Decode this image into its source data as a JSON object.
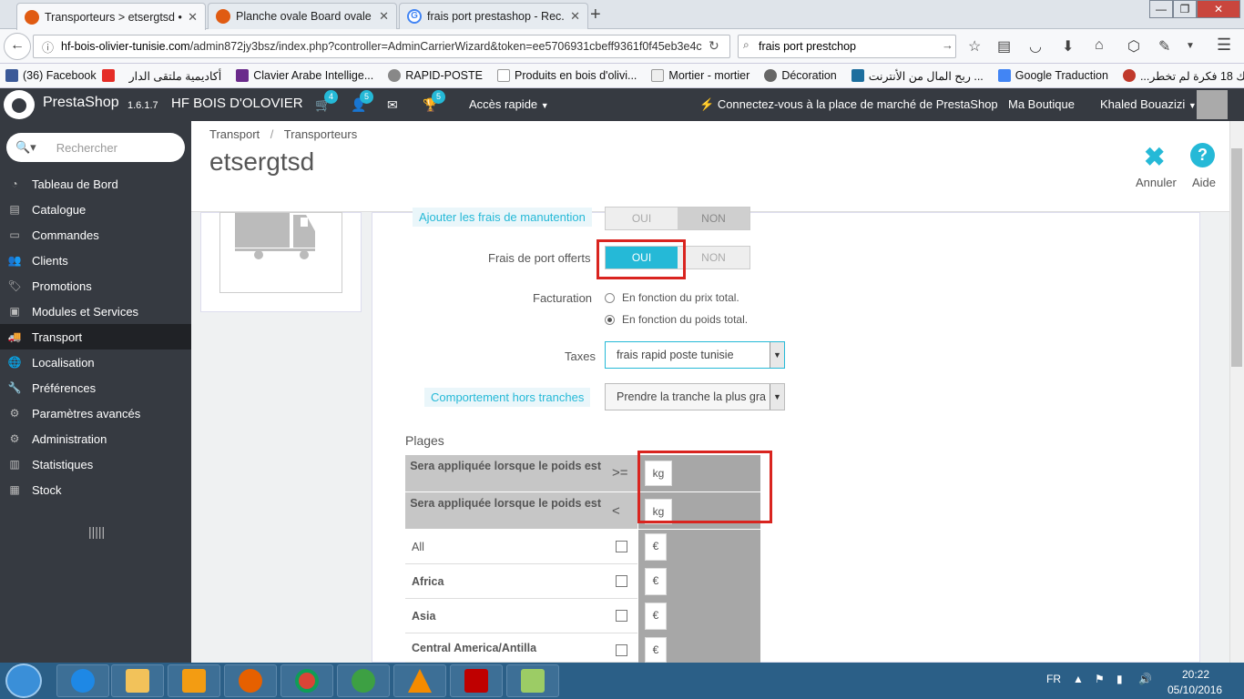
{
  "browser": {
    "tabs": [
      {
        "title": "Transporteurs > etsergtsd •..."
      },
      {
        "title": "Planche ovale Board ovale ..."
      },
      {
        "title": "frais port prestashop - Rec..."
      }
    ],
    "url_host": "hf-bois-olivier-tunisie.com",
    "url_path": "/admin872jy3bsz/index.php?controller=AdminCarrierWizard&token=ee5706931cbeff9361f0f45eb3e4c",
    "search_value": "frais port prestchop",
    "bookmarks": [
      "(36) Facebook",
      "أكاديمية ملتقى الدار",
      "Clavier Arabe Intellige...",
      "RAPID-POSTE",
      "Produits en bois d'olivi...",
      "Mortier - mortier",
      "Décoration",
      "ربح المال من الأنترنت ...",
      "Google Traduction",
      "...إليك 18 فكرة لم تخطر"
    ]
  },
  "header": {
    "brand": "PrestaShop",
    "version": "1.6.1.7",
    "shop_name": "HF BOIS D'OLOVIER",
    "badges": {
      "cart": "4",
      "customers": "5",
      "trophy": "5"
    },
    "quick_access": "Accès rapide",
    "marketplace": "Connectez-vous à la place de marché de PrestaShop",
    "my_shop": "Ma Boutique",
    "user": "Khaled Bouazizi"
  },
  "sidebar": {
    "search_placeholder": "Rechercher",
    "items": [
      {
        "label": "Tableau de Bord",
        "icon": "dashboard-icon"
      },
      {
        "label": "Catalogue",
        "icon": "book-icon"
      },
      {
        "label": "Commandes",
        "icon": "credit-card-icon"
      },
      {
        "label": "Clients",
        "icon": "users-icon"
      },
      {
        "label": "Promotions",
        "icon": "tags-icon"
      },
      {
        "label": "Modules et Services",
        "icon": "puzzle-icon"
      },
      {
        "label": "Transport",
        "icon": "truck-icon"
      },
      {
        "label": "Localisation",
        "icon": "globe-icon"
      },
      {
        "label": "Préférences",
        "icon": "wrench-icon"
      },
      {
        "label": "Paramètres avancés",
        "icon": "cogs-icon"
      },
      {
        "label": "Administration",
        "icon": "cog-icon"
      },
      {
        "label": "Statistiques",
        "icon": "bar-chart-icon"
      },
      {
        "label": "Stock",
        "icon": "archive-icon"
      }
    ],
    "active_index": 6
  },
  "page": {
    "breadcrumb_1": "Transport",
    "breadcrumb_sep": "/",
    "breadcrumb_2": "Transporteurs",
    "title": "etsergtsd",
    "cancel": "Annuler",
    "help": "Aide"
  },
  "form": {
    "handling_label": "Ajouter les frais de manutention",
    "free_shipping_label": "Frais de port offerts",
    "yes": "OUI",
    "no": "NON",
    "billing_label": "Facturation",
    "billing_option_1": "En fonction du prix total.",
    "billing_option_2": "En fonction du poids total.",
    "billing_selected": "En fonction du poids total.",
    "taxes_label": "Taxes",
    "taxes_value": "frais rapid poste tunisie",
    "out_of_range_label": "Comportement hors tranches",
    "out_of_range_value": "Prendre la tranche la plus gra",
    "handling_value": "NON",
    "free_shipping_value": "OUI"
  },
  "ranges": {
    "title": "Plages",
    "row1_label": "Sera appliquée lorsque le poids est",
    "row1_op": ">=",
    "row2_label": "Sera appliquée lorsque le poids est",
    "row2_op": "<",
    "unit": "kg",
    "currency": "€",
    "zones": [
      {
        "name": "All",
        "bold": false
      },
      {
        "name": "Africa",
        "bold": true
      },
      {
        "name": "Asia",
        "bold": true
      },
      {
        "name": "Central America/Antilla",
        "bold": true
      }
    ]
  },
  "taskbar": {
    "lang": "FR",
    "time": "20:22",
    "date": "05/10/2016"
  },
  "colors": {
    "accent": "#25b9d7",
    "header_bg": "#363a41",
    "highlight_red": "#d9241f"
  }
}
